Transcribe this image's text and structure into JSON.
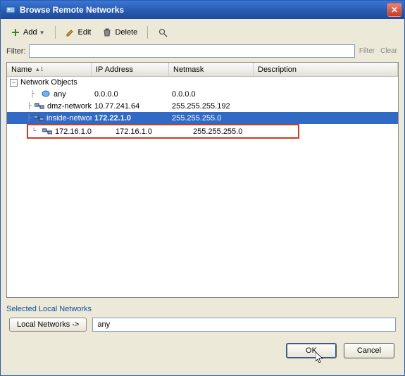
{
  "window": {
    "title": "Browse Remote Networks"
  },
  "toolbar": {
    "add_label": "Add",
    "edit_label": "Edit",
    "delete_label": "Delete"
  },
  "filter": {
    "label": "Filter:",
    "value": "",
    "filter_link": "Filter",
    "clear_link": "Clear"
  },
  "columns": {
    "name": "Name",
    "sort_marker": "▲1",
    "ip": "IP Address",
    "netmask": "Netmask",
    "description": "Description"
  },
  "group": {
    "label": "Network Objects"
  },
  "rows": [
    {
      "name": "any",
      "ip": "0.0.0.0",
      "mask": "0.0.0.0",
      "desc": "",
      "selected": false,
      "highlight": false,
      "icon": "any-icon"
    },
    {
      "name": "dmz-network",
      "ip": "10.77.241.64",
      "mask": "255.255.255.192",
      "desc": "",
      "selected": false,
      "highlight": false,
      "icon": "net-icon"
    },
    {
      "name": "inside-network",
      "ip": "172.22.1.0",
      "mask": "255.255.255.0",
      "desc": "",
      "selected": true,
      "highlight": false,
      "icon": "net-icon"
    },
    {
      "name": "172.16.1.0",
      "ip": "172.16.1.0",
      "mask": "255.255.255.0",
      "desc": "",
      "selected": false,
      "highlight": true,
      "icon": "net-icon"
    }
  ],
  "footer": {
    "section_label": "Selected Local Networks",
    "button_label": "Local Networks ->",
    "selected_value": "any"
  },
  "buttons": {
    "ok": "OK",
    "cancel": "Cancel"
  }
}
